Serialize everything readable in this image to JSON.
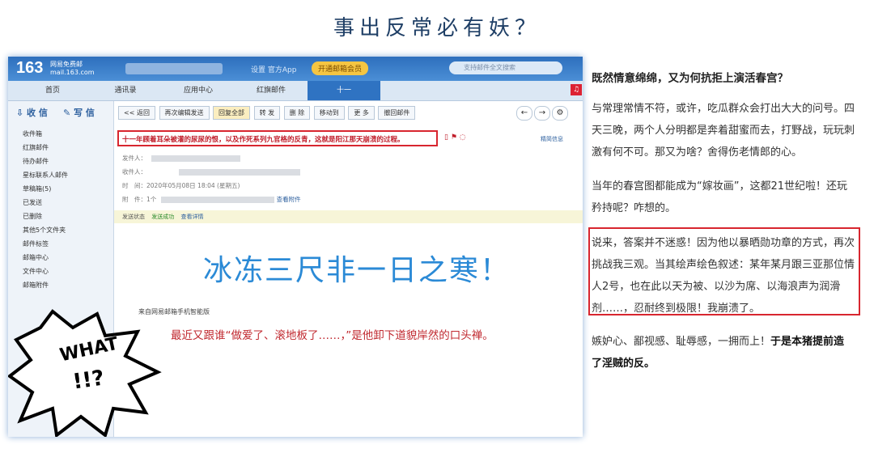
{
  "headline": "事出反常必有妖？",
  "screenshot": {
    "logo": "163",
    "logo_sub_line1": "网易免费邮",
    "logo_sub_line2": "mail.163.com",
    "top_links": "设置  官方App",
    "vip_label": "开通邮箱会员",
    "search_placeholder": "支持邮件全文搜索",
    "tabs": [
      "首页",
      "通讯录",
      "应用中心",
      "红旗邮件",
      "十一"
    ],
    "sidebar": {
      "receive": "收 信",
      "write": "写 信",
      "items": [
        "收件箱",
        "红旗邮件",
        "待办邮件",
        "星标联系人邮件",
        "草稿箱(5)",
        "已发送",
        "已删除",
        "其他5个文件夹",
        "邮件标签",
        "邮箱中心",
        "文件中心",
        "邮箱附件"
      ]
    },
    "toolbar": [
      "<< 返回",
      "再次编辑发送",
      "回复全部",
      "转 发",
      "删 除",
      "移动到",
      "更 多",
      "撤回邮件"
    ],
    "nav": [
      "←",
      "→",
      "⚙"
    ],
    "subject": "十一年顾着耳朵被灌的尿尿的恨，以及作死系列九官格的反青，这就是阳江那天崩溃的过程。",
    "simple_view": "精简信息",
    "meta": {
      "from_label": "发件人：",
      "to_label": "收件人：",
      "time_label": "时　间：",
      "time_value": "2020年05月08日 18:04 (星期五)",
      "att_label": "附　件：",
      "att_count": "1个",
      "att_link": "查看附件"
    },
    "status": {
      "label": "发送状态",
      "ok": "发送成功",
      "link": "查看详情"
    },
    "big_text": "冰冻三尺非一日之寒！",
    "from_phone": "来自网易邮箱手机智能版",
    "red_line": "最近又跟谁“做爱了、滚地板了……，”是他卸下道貌岸然的口头禅。",
    "burst_word": "WHAT",
    "burst_marks": "!!?"
  },
  "article": {
    "title": "既然情意绵绵，又为何抗拒上演活春宫？",
    "p1": "与常理常情不符，或许，吃瓜群众会打出大大的问号。四天三晚，两个人分明都是奔着甜蜜而去，打野战，玩玩刺激有何不可。那又为啥？舍得伤老情郎的心。",
    "p2": "当年的春宫图都能成为“嫁妆画”，这都21世纪啦！还玩矜持呢？咋想的。",
    "p3": "说来，答案并不迷惑！因为他以暴晒勋功章的方式，再次挑战我三观。当其绘声绘色叙述：某年某月跟三亚那位情人2号，也在此以天为被、以沙为席、以海浪声为润滑剂……，忍耐终到极限！我崩溃了。",
    "p4_normal": "嫉妒心、鄙视感、耻辱感，一拥而上！",
    "p4_bold": "于是本猪提前造了淫贼的反。"
  }
}
